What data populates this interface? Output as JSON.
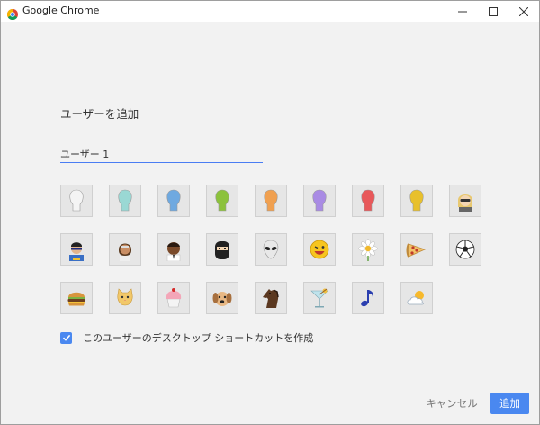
{
  "window": {
    "title": "Google Chrome"
  },
  "dialog": {
    "heading": "ユーザーを追加",
    "name_input": {
      "value": "ユーザー 1"
    },
    "avatars": [
      {
        "name": "avatar-generic-white-icon"
      },
      {
        "name": "avatar-generic-cyan-icon"
      },
      {
        "name": "avatar-generic-blue-icon"
      },
      {
        "name": "avatar-generic-green-icon"
      },
      {
        "name": "avatar-generic-orange-icon"
      },
      {
        "name": "avatar-generic-purple-icon"
      },
      {
        "name": "avatar-generic-red-icon"
      },
      {
        "name": "avatar-generic-yellow-icon"
      },
      {
        "name": "avatar-secret-agent-icon"
      },
      {
        "name": "avatar-superhero-icon"
      },
      {
        "name": "avatar-volleyball-player-icon"
      },
      {
        "name": "avatar-businessman-icon"
      },
      {
        "name": "avatar-ninja-icon"
      },
      {
        "name": "avatar-alien-icon"
      },
      {
        "name": "avatar-smiley-icon"
      },
      {
        "name": "avatar-flower-icon"
      },
      {
        "name": "avatar-pizza-icon"
      },
      {
        "name": "avatar-soccer-ball-icon"
      },
      {
        "name": "avatar-burger-icon"
      },
      {
        "name": "avatar-cat-icon"
      },
      {
        "name": "avatar-cupcake-icon"
      },
      {
        "name": "avatar-dog-icon"
      },
      {
        "name": "avatar-horse-icon"
      },
      {
        "name": "avatar-cocktail-icon"
      },
      {
        "name": "avatar-music-note-icon"
      },
      {
        "name": "avatar-sun-cloud-icon"
      }
    ],
    "shortcut_checkbox": {
      "checked": true,
      "label": "このユーザーのデスクトップ ショートカットを作成"
    },
    "cancel_label": "キャンセル",
    "add_label": "追加"
  },
  "colors": {
    "accent": "#4a88f0",
    "background": "#f2f2f2"
  }
}
